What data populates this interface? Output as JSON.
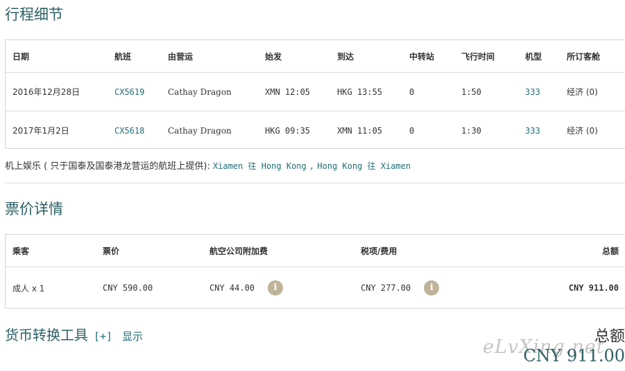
{
  "itinerary": {
    "title": "行程细节",
    "headers": [
      "日期",
      "航班",
      "由营运",
      "始发",
      "到达",
      "中转站",
      "飞行时间",
      "机型",
      "所订客舱"
    ],
    "rows": [
      {
        "date": "2016年12月28日",
        "flight": "CX5619",
        "operator": "Cathay Dragon",
        "depart": "XMN 12:05",
        "arrive": "HKG 13:55",
        "stops": "0",
        "duration": "1:50",
        "aircraft": "333",
        "cabin": "经济 (0)"
      },
      {
        "date": "2017年1月2日",
        "flight": "CX5618",
        "operator": "Cathay Dragon",
        "depart": "HKG 09:35",
        "arrive": "XMN 11:05",
        "stops": "0",
        "duration": "1:30",
        "aircraft": "333",
        "cabin": "经济 (0)"
      }
    ]
  },
  "entertainment": {
    "label": "机上娱乐 ( 只于国泰及国泰港龙营运的航班上提供):",
    "route1": "Xiamen 往 Hong Kong",
    "separator": ",",
    "route2": "Hong Kong 往 Xiamen"
  },
  "fare": {
    "title": "票价详情",
    "headers": {
      "passenger": "乘客",
      "fare": "票价",
      "surcharge": "航空公司附加费",
      "taxes": "税项/费用",
      "total": "总额"
    },
    "row": {
      "passenger": "成人 x 1",
      "fare": "CNY 590.00",
      "surcharge": "CNY 44.00",
      "taxes": "CNY 277.00",
      "total": "CNY 911.00"
    }
  },
  "currency_tool": {
    "title": "货币转换工具",
    "toggle": "[+]",
    "show": "显示"
  },
  "grand_total": {
    "label": "总额",
    "value": "CNY 911.00"
  },
  "watermark": "eLvXing.net",
  "colors": {
    "heading": "#2c5f63",
    "link": "#1f6e77",
    "info_icon": "#bfb39a"
  },
  "icons": [
    "info-icon"
  ]
}
